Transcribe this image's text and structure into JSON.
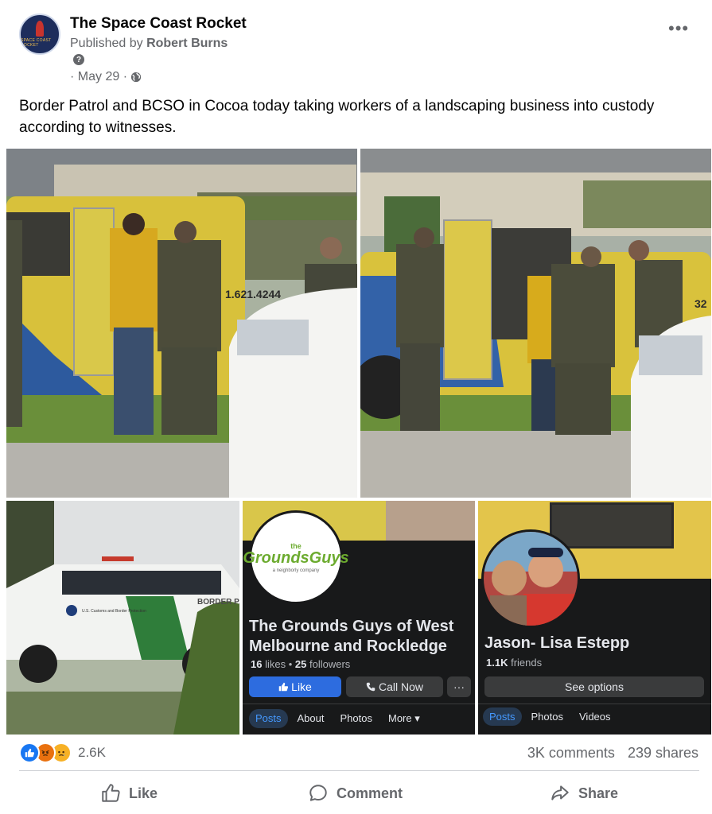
{
  "post": {
    "page_name": "The Space Coast Rocket",
    "publisher_prefix": "Published by",
    "publisher_name": "Robert Burns",
    "help_glyph": "?",
    "date": "· May 29 ·",
    "caption": "Border Patrol and BCSO in Cocoa today taking workers of a landscaping business into custody according to witnesses.",
    "more_glyph": "•••",
    "avatar_text": "SPACE COAST ROCKET"
  },
  "photos": {
    "truck_phone": "1.621.4244",
    "truck_number": "32",
    "border_patrol_text": "BORDER PAT",
    "customs_text": "U.S. Customs and Border Protection",
    "page_card": {
      "logo_top": "the",
      "logo_main": "GroundsGuys",
      "logo_sub": "a neighborly company",
      "title": "The Grounds Guys of West Melbourne and Rockledge",
      "likes_count": "16",
      "likes_label": "likes",
      "separator": "•",
      "followers_count": "25",
      "followers_label": "followers",
      "like_button": "Like",
      "call_button": "Call Now",
      "more_button": "···",
      "tabs": [
        "Posts",
        "About",
        "Photos",
        "More ▾"
      ]
    },
    "profile_card": {
      "name": "Jason- Lisa Estepp",
      "friends_count": "1.1K",
      "friends_label": "friends",
      "see_options": "See options",
      "tabs": [
        "Posts",
        "Photos",
        "Videos"
      ]
    }
  },
  "stats": {
    "reaction_icons": [
      "like-icon",
      "angry-icon",
      "sad-icon"
    ],
    "reaction_count": "2.6K",
    "comments": "3K comments",
    "shares": "239 shares"
  },
  "actions": {
    "like": "Like",
    "comment": "Comment",
    "share": "Share"
  },
  "colors": {
    "fb_blue": "#1877f2",
    "muted_text": "#65676b",
    "dark_card": "#18191a"
  }
}
